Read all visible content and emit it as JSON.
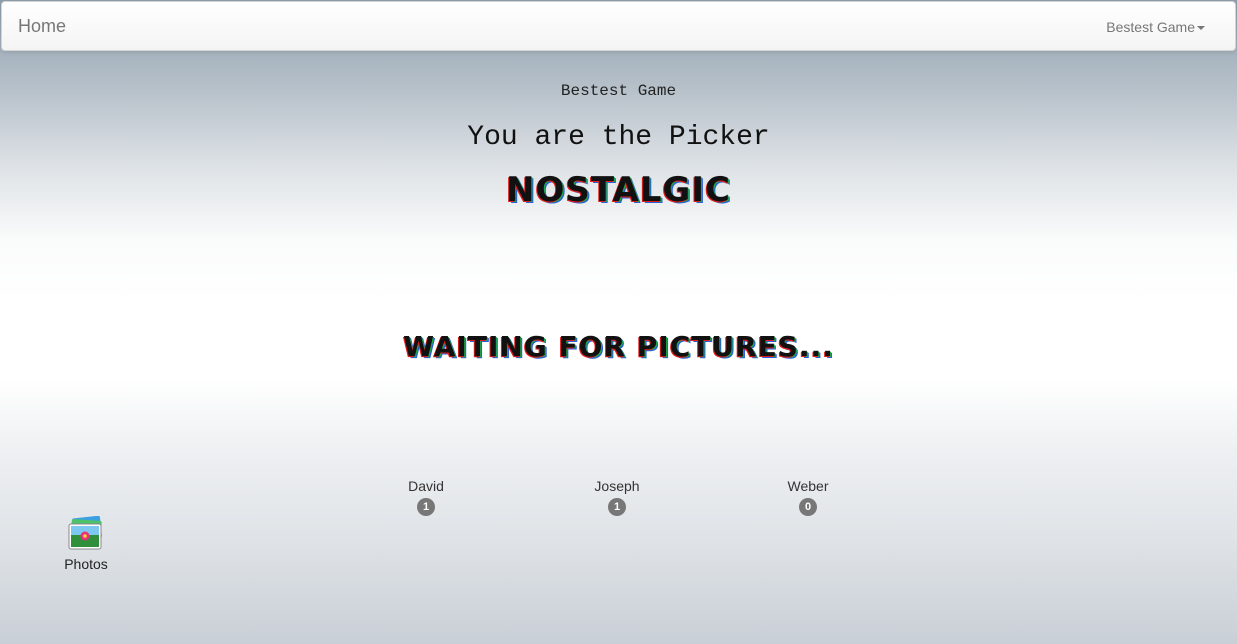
{
  "navbar": {
    "brand": "Home",
    "dropdown_label": "Bestest Game"
  },
  "game": {
    "name": "Bestest Game",
    "role_text": "You are the Picker",
    "word": "NOSTALGIC",
    "status": "WAITING FOR PICTURES..."
  },
  "players": [
    {
      "name": "David",
      "score": "1"
    },
    {
      "name": "Joseph",
      "score": "1"
    },
    {
      "name": "Weber",
      "score": "0"
    }
  ],
  "desktop": {
    "icon_label": "Photos",
    "icon": "photos-app-icon"
  },
  "colors": {
    "badge": "#777777",
    "navbar_text": "#777777"
  }
}
